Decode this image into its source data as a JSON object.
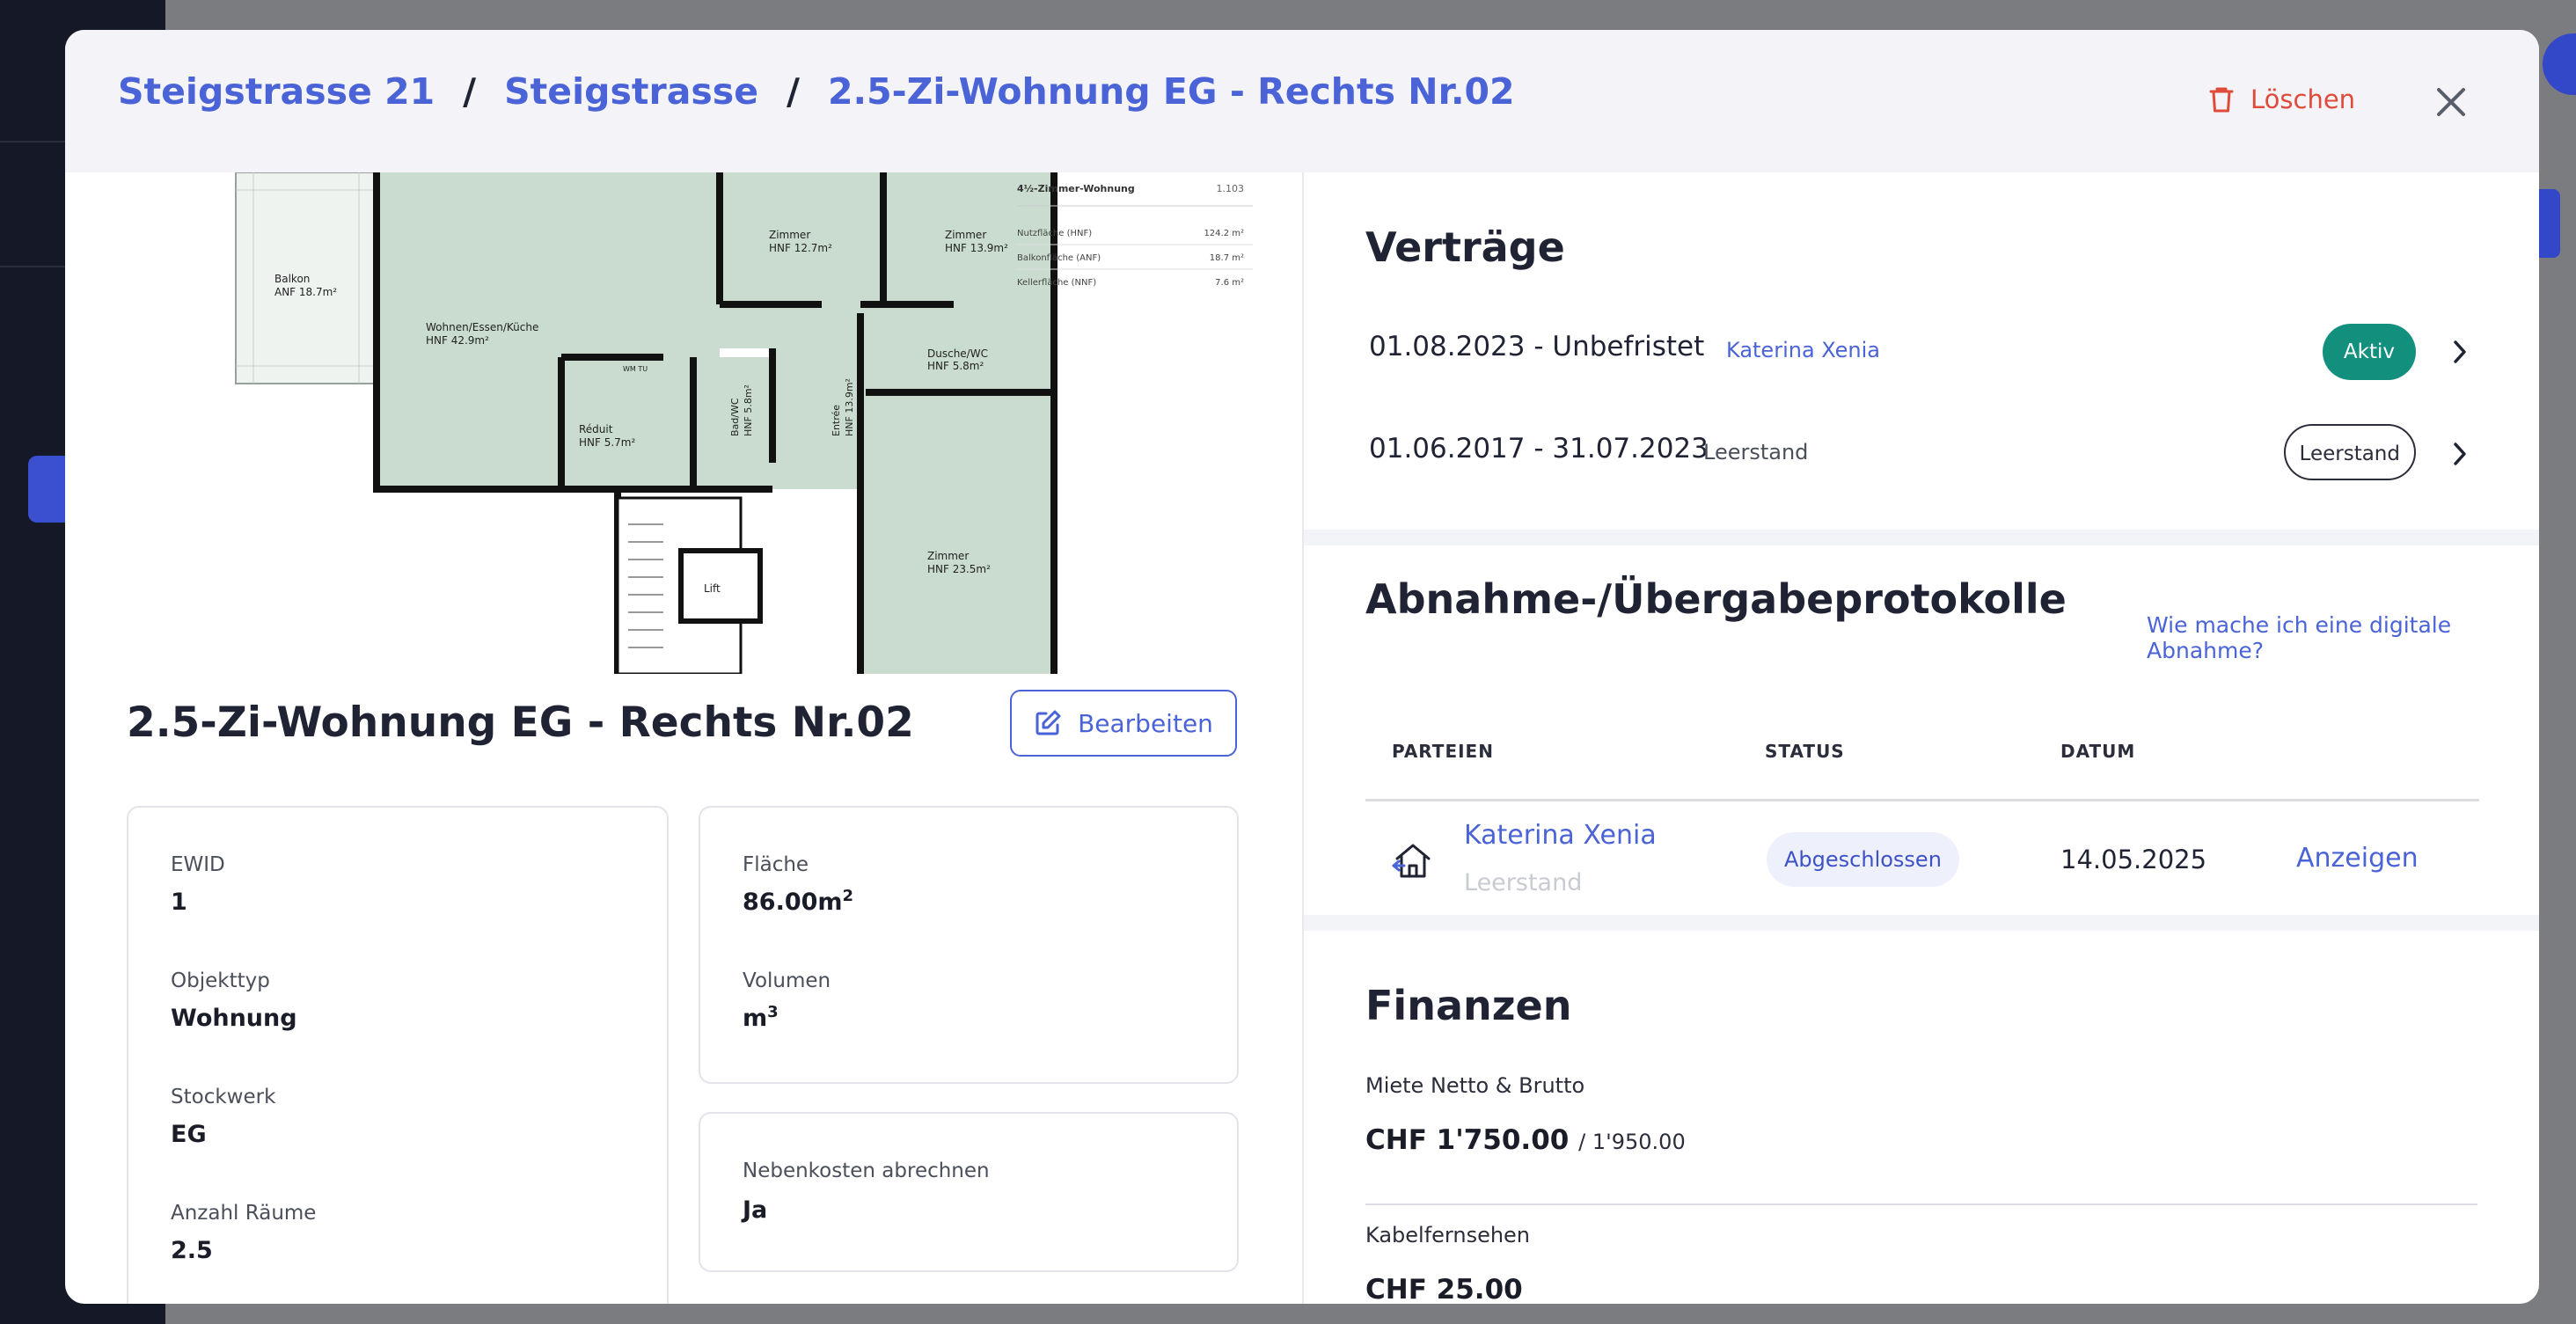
{
  "breadcrumb": {
    "items": [
      "Steigstrasse 21",
      "Steigstrasse",
      "2.5-Zi-Wohnung EG - Rechts Nr.02"
    ],
    "separator": "/"
  },
  "header": {
    "delete_label": "Löschen"
  },
  "floorplan": {
    "rooms": {
      "balkon": [
        "Balkon",
        "ANF 18.7m²"
      ],
      "wohnen": [
        "Wohnen/Essen/Küche",
        "HNF 42.9m²"
      ],
      "zimmer1": [
        "Zimmer",
        "HNF 12.7m²"
      ],
      "zimmer2": [
        "Zimmer",
        "HNF 13.9m²"
      ],
      "dusche": [
        "Dusche/WC",
        "HNF 5.8m²"
      ],
      "reduit": [
        "Réduit",
        "HNF 5.7m²"
      ],
      "bad": [
        "Bad/WC",
        "HNF 5.8m²"
      ],
      "entree": [
        "Entrée",
        "HNF 13.9m²"
      ],
      "zimmer3": [
        "Zimmer",
        "HNF 23.5m²"
      ],
      "lift": "Lift",
      "wm": "WM TU"
    },
    "legend": {
      "title": "4½-Zimmer-Wohnung",
      "number": "1.103",
      "rows": [
        {
          "label": "Nutzfläche (HNF)",
          "value": "124.2 m²"
        },
        {
          "label": "Balkonfläche (ANF)",
          "value": "18.7 m²"
        },
        {
          "label": "Kellerfläche (NNF)",
          "value": "7.6 m²"
        }
      ]
    }
  },
  "unit": {
    "title": "2.5-Zi-Wohnung EG - Rechts Nr.02",
    "edit_label": "Bearbeiten",
    "fields_left": [
      {
        "label": "EWID",
        "value": "1"
      },
      {
        "label": "Objekttyp",
        "value": "Wohnung"
      },
      {
        "label": "Stockwerk",
        "value": "EG"
      },
      {
        "label": "Anzahl Räume",
        "value": "2.5"
      }
    ],
    "flaeche": {
      "label": "Fläche",
      "value": "86.00m",
      "sup": "2"
    },
    "volumen": {
      "label": "Volumen",
      "value": "m",
      "sup": "3"
    },
    "nebenkosten": {
      "label": "Nebenkosten abrechnen",
      "value": "Ja"
    }
  },
  "contracts": {
    "title": "Verträge",
    "rows": [
      {
        "dates": "01.08.2023 - Unbefristet",
        "sub": "Katerina Xenia",
        "badge": "Aktiv"
      },
      {
        "dates": "01.06.2017 - 31.07.2023",
        "sub": "Leerstand",
        "badge": "Leerstand"
      }
    ]
  },
  "protocols": {
    "title": "Abnahme-/Übergabeprotokolle",
    "help_link": "Wie mache ich eine digitale Abnahme?",
    "columns": [
      "PARTEIEN",
      "STATUS",
      "DATUM"
    ],
    "row": {
      "party": "Katerina Xenia",
      "party_sub": "Leerstand",
      "status": "Abgeschlossen",
      "date": "14.05.2025",
      "action": "Anzeigen"
    }
  },
  "finances": {
    "title": "Finanzen",
    "rent_label": "Miete Netto & Brutto",
    "rent_net": "CHF 1'750.00",
    "rent_gross": "/ 1'950.00",
    "cable_label": "Kabelfernsehen",
    "cable_value": "CHF 25.00"
  },
  "colors": {
    "accent": "#4a63d6",
    "danger": "#e04a3a",
    "active_badge": "#138f7e",
    "sidebar": "#151826"
  }
}
